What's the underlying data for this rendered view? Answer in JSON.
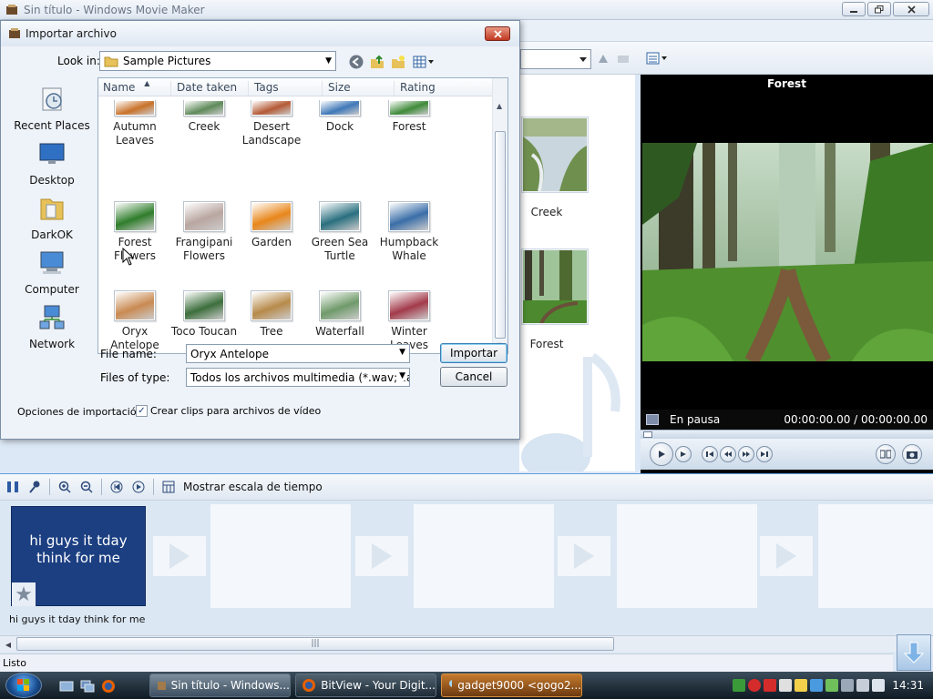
{
  "main_window": {
    "title": "Sin título - Windows Movie Maker"
  },
  "content_pane": {
    "items": [
      {
        "label": "Creek"
      },
      {
        "label": "Forest"
      }
    ]
  },
  "preview": {
    "title": "Forest",
    "status": "En pausa",
    "time": "00:00:00.00 / 00:00:00.00"
  },
  "timeline_toolbar": {
    "toggle_label": "Mostrar escala de tiempo"
  },
  "storyboard": {
    "clip_text": "hi guys it tday think for me",
    "clip_caption": "hi guys it tday think for me"
  },
  "statusbar": {
    "text": "Listo"
  },
  "taskbar": {
    "buttons": [
      {
        "label": "Sin título - Windows..."
      },
      {
        "label": "BitView - Your Digit..."
      },
      {
        "label": "gadget9000 <gogo2..."
      }
    ],
    "clock": "14:31"
  },
  "dialog": {
    "title": "Importar archivo",
    "look_in_label": "Look in:",
    "look_in_value": "Sample Pictures",
    "places": [
      {
        "label": "Recent Places",
        "icon": "recent-places-icon"
      },
      {
        "label": "Desktop",
        "icon": "desktop-icon"
      },
      {
        "label": "DarkOK",
        "icon": "user-folder-icon"
      },
      {
        "label": "Computer",
        "icon": "computer-icon"
      },
      {
        "label": "Network",
        "icon": "network-icon"
      }
    ],
    "columns": [
      "Name",
      "Date taken",
      "Tags",
      "Size",
      "Rating"
    ],
    "files": [
      {
        "name": "Autumn Leaves",
        "line1": "Autumn",
        "line2": "Leaves",
        "color": "#c9722a"
      },
      {
        "name": "Creek",
        "line1": "Creek",
        "line2": "",
        "color": "#5f8a5a"
      },
      {
        "name": "Desert Landscape",
        "line1": "Desert",
        "line2": "Landscape",
        "color": "#b45a36"
      },
      {
        "name": "Dock",
        "line1": "Dock",
        "line2": "",
        "color": "#3f78b8"
      },
      {
        "name": "Forest",
        "line1": "Forest",
        "line2": "",
        "color": "#3f8a3a"
      },
      {
        "name": "Forest Flowers",
        "line1": "Forest",
        "line2": "Flowers",
        "color": "#2f7d2b"
      },
      {
        "name": "Frangipani Flowers",
        "line1": "Frangipani",
        "line2": "Flowers",
        "color": "#b9a6a0"
      },
      {
        "name": "Garden",
        "line1": "Garden",
        "line2": "",
        "color": "#e8861a"
      },
      {
        "name": "Green Sea Turtle",
        "line1": "Green Sea",
        "line2": "Turtle",
        "color": "#2a6f7f"
      },
      {
        "name": "Humpback Whale",
        "line1": "Humpback",
        "line2": "Whale",
        "color": "#3a6ea8"
      },
      {
        "name": "Oryx Antelope",
        "line1": "Oryx",
        "line2": "Antelope",
        "color": "#c98a52"
      },
      {
        "name": "Toco Toucan",
        "line1": "Toco Toucan",
        "line2": "",
        "color": "#3c6e3c"
      },
      {
        "name": "Tree",
        "line1": "Tree",
        "line2": "",
        "color": "#b78a4a"
      },
      {
        "name": "Waterfall",
        "line1": "Waterfall",
        "line2": "",
        "color": "#6f9a6a"
      },
      {
        "name": "Winter Leaves",
        "line1": "Winter",
        "line2": "Leaves",
        "color": "#a33a4a"
      }
    ],
    "file_name_label": "File name:",
    "file_name_value": "Oryx Antelope",
    "file_type_label": "Files of type:",
    "file_type_value": "Todos los archivos multimedia (*.wav;*.aif;*.aiff;",
    "import_button": "Importar",
    "cancel_button": "Cancel",
    "options_label": "Opciones de importación:",
    "create_clips_label": "Crear clips para archivos de vídeo",
    "create_clips_checked": "✓"
  }
}
